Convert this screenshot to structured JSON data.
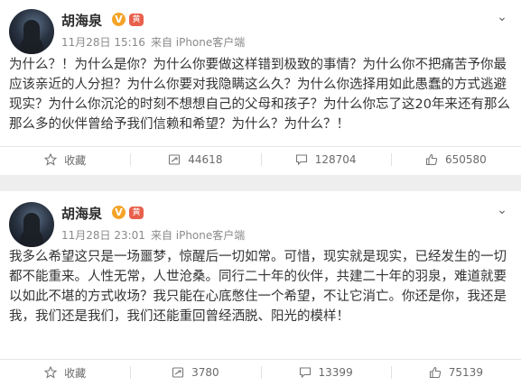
{
  "posts": [
    {
      "author": "胡海泉",
      "v_badge": "V",
      "id_badge": "黄",
      "time": "11月28日 15:16",
      "source": "来自 iPhone客户端",
      "text": "为什么？！为什么是你？为什么你要做这样错到极致的事情？为什么你不把痛苦予你最应该亲近的人分担？为什么你要对我隐瞒这么久？为什么你选择用如此愚蠢的方式逃避现实？为什么你沉沦的时刻不想想自己的父母和孩子？为什么你忘了这20年来还有那么那么多的伙伴曾给予我们信赖和希望？为什么？为什么？！",
      "actions": {
        "favorite": "收藏",
        "repost": "44618",
        "comment": "128704",
        "like": "650580"
      }
    },
    {
      "author": "胡海泉",
      "v_badge": "V",
      "id_badge": "黄",
      "time": "11月28日 23:01",
      "source": "来自 iPhone客户端",
      "text": "我多么希望这只是一场噩梦，惊醒后一切如常。可惜，现实就是现实，已经发生的一切都不能重来。人性无常，人世沧桑。同行二十年的伙伴，共建二十年的羽泉，难道就要以如此不堪的方式收场？我只能在心底憋住一个希望，不让它消亡。你还是你，我还是我，我们还是我们，我们还能重回曾经洒脱、阳光的模样！",
      "actions": {
        "favorite": "收藏",
        "repost": "3780",
        "comment": "13399",
        "like": "75139"
      }
    }
  ],
  "colors": {
    "accent_badge": "#f3a428",
    "meta": "#8a8a8a",
    "separator": "#eeeeee"
  }
}
